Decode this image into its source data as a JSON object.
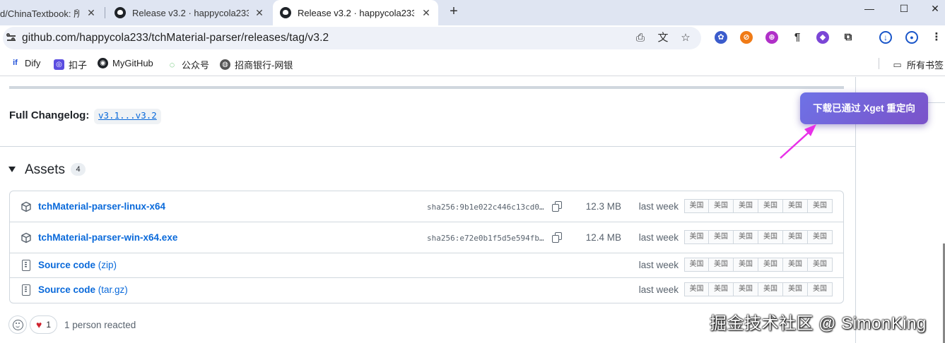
{
  "browser": {
    "tabs": [
      {
        "title": "d/ChinaTextbook: 所",
        "active": false
      },
      {
        "title": "Release v3.2 · happycola233/",
        "active": false
      },
      {
        "title": "Release v3.2 · happycola233/",
        "active": true
      }
    ],
    "new_tab_symbol": "+",
    "url": "github.com/happycola233/tchMaterial-parser/releases/tag/v3.2",
    "bookmarks": [
      {
        "label": "Dify",
        "icon": "dify-icon"
      },
      {
        "label": "扣子",
        "icon": "coze-icon"
      },
      {
        "label": "MyGitHub",
        "icon": "github-icon"
      },
      {
        "label": "公众号",
        "icon": "wechat-icon"
      },
      {
        "label": "招商银行-网银",
        "icon": "globe-icon"
      }
    ],
    "all_bookmarks": "所有书签"
  },
  "release": {
    "full_changelog_label": "Full Changelog:",
    "full_changelog_link": "v3.1...v3.2",
    "assets_title": "Assets",
    "assets_count": "4",
    "assets": [
      {
        "name": "tchMaterial-parser-linux-x64",
        "suffix": "",
        "sha": "sha256:9b1e022c446c13cd0…",
        "size": "12.3 MB",
        "date": "last week"
      },
      {
        "name": "tchMaterial-parser-win-x64.exe",
        "suffix": "",
        "sha": "sha256:e72e0b1f5d5e594fb…",
        "size": "12.4 MB",
        "date": "last week"
      },
      {
        "name": "Source code",
        "suffix": " (zip)",
        "sha": "",
        "size": "",
        "date": "last week"
      },
      {
        "name": "Source code",
        "suffix": " (tar.gz)",
        "sha": "",
        "size": "",
        "date": "last week"
      }
    ],
    "mirror_label": "美国",
    "reaction_count": "1",
    "reaction_text": "1 person reacted"
  },
  "popup": {
    "text": "下载已通过 Xget 重定向"
  },
  "watermark": "掘金技术社区 @ SimonKing",
  "colors": {
    "link": "#0969da",
    "popup_start": "#6e72e6",
    "popup_end": "#7b52c9",
    "arrow": "#e830e8"
  }
}
